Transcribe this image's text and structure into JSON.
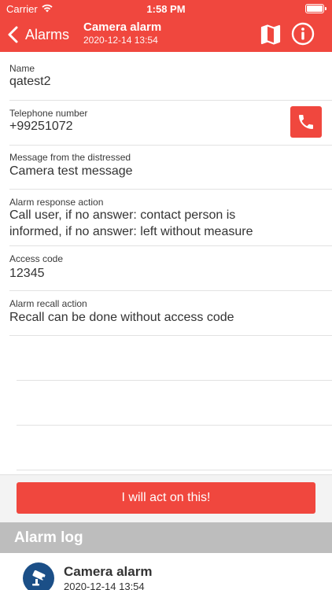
{
  "status_bar": {
    "carrier": "Carrier",
    "time": "1:58 PM"
  },
  "nav": {
    "back_label": "Alarms",
    "title": "Camera alarm",
    "subtitle": "2020-12-14 13:54"
  },
  "fields": {
    "name": {
      "label": "Name",
      "value": "qatest2"
    },
    "phone": {
      "label": "Telephone number",
      "value": "+99251072"
    },
    "message": {
      "label": "Message from the distressed",
      "value": "Camera test message"
    },
    "response": {
      "label": "Alarm response action",
      "line1": "Call user, if no answer: contact person is",
      "line2": "informed, if no answer: left without measure"
    },
    "access": {
      "label": "Access code",
      "value": "12345"
    },
    "recall": {
      "label": "Alarm recall action",
      "value": "Recall can be done without access code"
    }
  },
  "act_button": {
    "label": "I will act on this!"
  },
  "alarm_log": {
    "header": "Alarm log",
    "entries": [
      {
        "title": "Camera alarm",
        "time": "2020-12-14 13:54",
        "icon": "cctv-camera-icon"
      }
    ]
  },
  "colors": {
    "accent": "#f0473e",
    "link": "#2a7ec9",
    "log_icon_bg": "#1b4f87",
    "log_header": "#bdbdbd"
  }
}
